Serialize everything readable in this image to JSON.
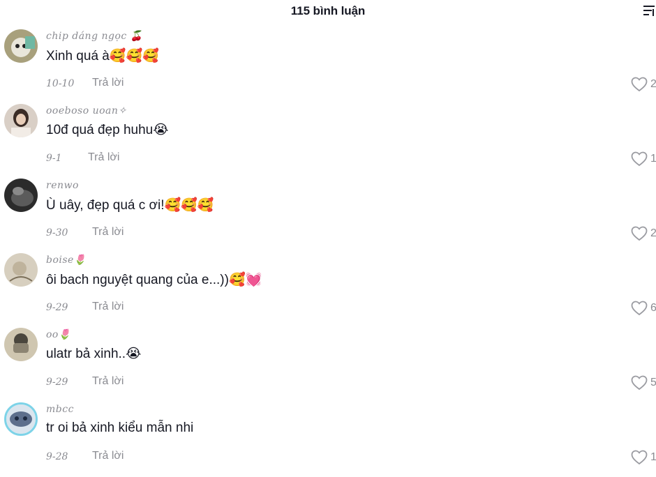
{
  "header": {
    "title": "115 bình luận",
    "filter_icon": "sort-lines-icon"
  },
  "comments": [
    {
      "username": "chip dáng ngọc 🍒",
      "text": "Xinh quá à🥰🥰🥰",
      "timestamp": "10-10",
      "reply_label": "Trả lời",
      "likes": "2",
      "avatar_color": "#9a8f6a"
    },
    {
      "username": "ooeboso uoan✧",
      "text": "10đ quá đẹp huhu😭",
      "timestamp": "9-1",
      "reply_label": "Trả lời",
      "likes": "1",
      "avatar_color": "#b59a8c"
    },
    {
      "username": "renwo",
      "text": "Ù uây, đẹp quá c ơi!🥰🥰🥰",
      "timestamp": "9-30",
      "reply_label": "Trả lời",
      "likes": "2",
      "avatar_color": "#3a3a3a"
    },
    {
      "username": "boise🌷",
      "text": "ôi bach nguyệt quang của e...))🥰💓",
      "timestamp": "9-29",
      "reply_label": "Trả lời",
      "likes": "6",
      "avatar_color": "#c9bfae"
    },
    {
      "username": "oo🌷",
      "text": "ulatr bả xinh..😭",
      "timestamp": "9-29",
      "reply_label": "Trả lời",
      "likes": "5",
      "avatar_color": "#b8ad93"
    },
    {
      "username": "mbcc",
      "text": "tr oi bả xinh kiểu mẫn nhi",
      "timestamp": "9-28",
      "reply_label": "Trả lời",
      "likes": "1",
      "avatar_color": "#6d7a95"
    }
  ]
}
